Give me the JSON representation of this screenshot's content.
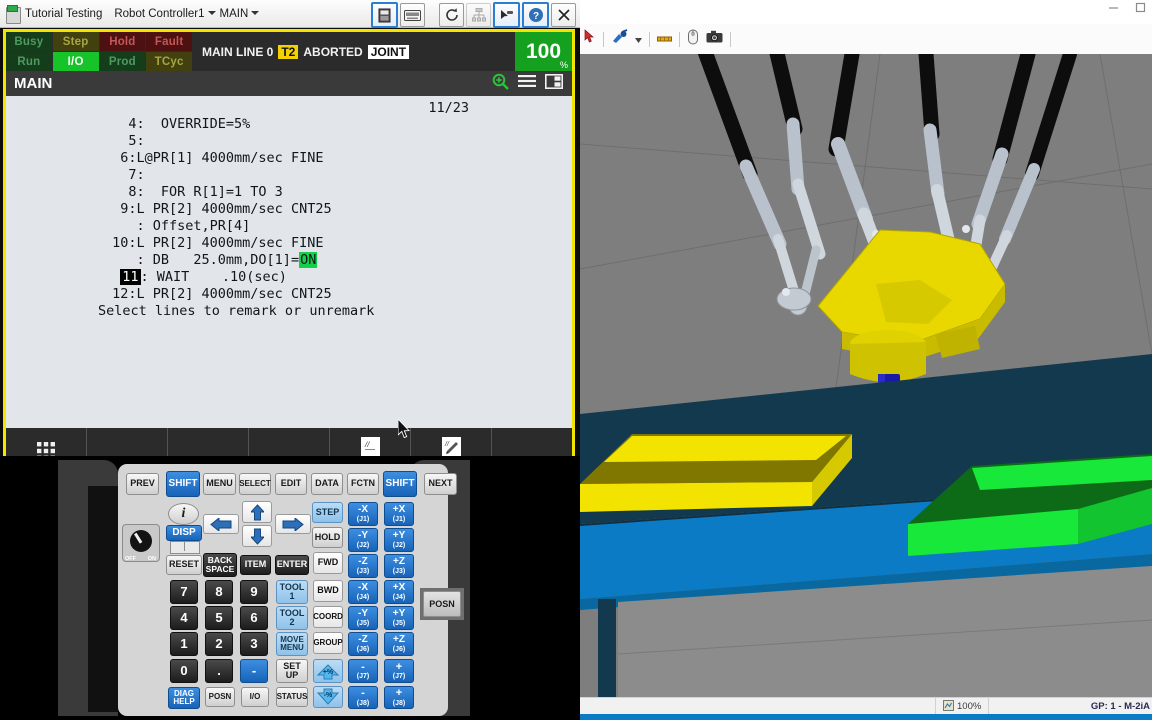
{
  "pendant": {
    "titlebar": {
      "app_title": "Tutorial Testing",
      "controller": "Robot Controller1",
      "program_menu": "MAIN",
      "icons": [
        "pendant-icon",
        "keyboard-icon",
        "reset-icon",
        "hierarchy-icon",
        "pointer-icon",
        "help-icon",
        "close-icon"
      ]
    },
    "leds": [
      {
        "label": "Busy",
        "color": "#153d1c",
        "text": "#4e9b5e",
        "active": false
      },
      {
        "label": "Step",
        "color": "#41400e",
        "text": "#a8a543",
        "active": false
      },
      {
        "label": "Hold",
        "color": "#4d1111",
        "text": "#c45757",
        "active": false
      },
      {
        "label": "Fault",
        "color": "#4d1111",
        "text": "#c45757",
        "active": false
      },
      {
        "label": "Run",
        "color": "#153d1c",
        "text": "#4e9b5e",
        "active": false
      },
      {
        "label": "I/O",
        "color": "#16c42a",
        "text": "#ffffff",
        "active": true
      },
      {
        "label": "Prod",
        "color": "#153d1c",
        "text": "#4e9b5e",
        "active": false
      },
      {
        "label": "TCyc",
        "color": "#41400e",
        "text": "#a8a543",
        "active": false
      }
    ],
    "status_line": {
      "program": "MAIN LINE 0",
      "mode_badge": "T2",
      "state": "ABORTED",
      "coord_badge": "JOINT"
    },
    "override": {
      "value": "100",
      "unit": "%"
    },
    "program_bar": {
      "name": "MAIN",
      "icons": [
        "zoom-in-icon",
        "menu-icon",
        "split-view-icon"
      ]
    },
    "code": {
      "line_counter": "11/23",
      "lines": [
        {
          "num": "4:",
          "text": "  OVERRIDE=5%"
        },
        {
          "num": "5:",
          "text": ""
        },
        {
          "num": "6:L",
          "text": "@PR[1] 4000mm/sec FINE"
        },
        {
          "num": "7:",
          "text": ""
        },
        {
          "num": "8:",
          "text": "  FOR R[1]=1 TO 3"
        },
        {
          "num": "9:L",
          "text": " PR[2] 4000mm/sec CNT25"
        },
        {
          "num": ":",
          "text": " Offset,PR[4]"
        },
        {
          "num": "10:L",
          "text": " PR[2] 4000mm/sec FINE"
        },
        {
          "num": ":",
          "text": " DB   25.0mm,DO[1]=",
          "highlight": "ON"
        },
        {
          "num": "11:",
          "text": " WAIT    .10(sec)",
          "selected": true
        },
        {
          "num": "12:L",
          "text": " PR[2] 4000mm/sec CNT25"
        }
      ],
      "prompt": "Select lines to remark or unremark"
    },
    "softkeys": [
      {
        "label": "",
        "icon": "grid-icon"
      },
      {
        "label": "",
        "icon": ""
      },
      {
        "label": "",
        "icon": ""
      },
      {
        "label": "",
        "icon": ""
      },
      {
        "label": "REMARK",
        "icon": "remark-icon"
      },
      {
        "label": "UNREMARK",
        "icon": "unremark-icon"
      },
      {
        "label": "",
        "icon": ""
      }
    ],
    "keypad": {
      "row_top": [
        "PREV",
        "SHIFT",
        "MENU",
        "SELECT",
        "EDIT",
        "DATA",
        "FCTN",
        "SHIFT",
        "NEXT"
      ],
      "power_switch": {
        "off": "OFF",
        "on": "ON"
      },
      "keys": [
        {
          "label": "i",
          "style": "gray"
        },
        {
          "label": "DISP",
          "style": "blue"
        },
        {
          "label": "RESET",
          "style": "gray"
        },
        {
          "label": "BACK SPACE",
          "style": "dark"
        },
        {
          "label": "ITEM",
          "style": "dark"
        },
        {
          "label": "ENTER",
          "style": "dark"
        },
        {
          "label": "STEP",
          "style": "ltblue"
        },
        {
          "label": "HOLD",
          "style": "gray"
        },
        {
          "label": "FWD",
          "style": "white"
        },
        {
          "label": "BWD",
          "style": "white"
        },
        {
          "label": "COORD",
          "style": "white"
        },
        {
          "label": "GROUP",
          "style": "white"
        },
        {
          "label": "TOOL 1",
          "style": "ltblue"
        },
        {
          "label": "TOOL 2",
          "style": "ltblue"
        },
        {
          "label": "MOVE MENU",
          "style": "ltblue"
        },
        {
          "label": "SET UP",
          "style": "gray"
        },
        {
          "label": "DIAG HELP",
          "style": "blue"
        },
        {
          "label": "POSN",
          "style": "gray"
        },
        {
          "label": "I/O",
          "style": "gray"
        },
        {
          "label": "STATUS",
          "style": "gray"
        }
      ],
      "numpad": [
        "7",
        "8",
        "9",
        "4",
        "5",
        "6",
        "1",
        "2",
        "3",
        "0",
        ".",
        "-"
      ],
      "jog": [
        {
          "axis": "-X",
          "joint": "(J1)"
        },
        {
          "axis": "+X",
          "joint": "(J1)"
        },
        {
          "axis": "-Y",
          "joint": "(J2)"
        },
        {
          "axis": "+Y",
          "joint": "(J2)"
        },
        {
          "axis": "-Z",
          "joint": "(J3)"
        },
        {
          "axis": "+Z",
          "joint": "(J3)"
        },
        {
          "axis": "-X",
          "joint": "(J4)"
        },
        {
          "axis": "+X",
          "joint": "(J4)"
        },
        {
          "axis": "-Y",
          "joint": "(J5)"
        },
        {
          "axis": "+Y",
          "joint": "(J5)"
        },
        {
          "axis": "-Z",
          "joint": "(J6)"
        },
        {
          "axis": "+Z",
          "joint": "(J6)"
        },
        {
          "axis": "-",
          "joint": "(J7)"
        },
        {
          "axis": "+",
          "joint": "(J7)"
        },
        {
          "axis": "-",
          "joint": "(J8)"
        },
        {
          "axis": "+",
          "joint": "(J8)"
        }
      ],
      "pct_keys": [
        "+%",
        "-%"
      ],
      "side_key": "POSN"
    }
  },
  "sim": {
    "toolbar_icons": [
      "pointer-icon",
      "teach-tool-icon",
      "dropdown-caret-icon",
      "measure-icon",
      "mouse-icon",
      "camera-icon"
    ],
    "window_buttons": [
      "minimize-icon",
      "maximize-icon"
    ],
    "status": {
      "zoom": "100%",
      "group": "GP: 1 - M-2iA"
    },
    "scene": {
      "robot": "delta-robot-m2ia",
      "background_color": "#7e7e7e",
      "conveyor_color": "#12394d",
      "band_color": "#0a7bc4",
      "floor_color": "#8c8c8c",
      "parts": [
        {
          "name": "yellow-box",
          "color": "#f2e400"
        },
        {
          "name": "green-box",
          "color": "#17e83a"
        }
      ],
      "end_effector_color": "#e8d800",
      "tool_color": "#1a1aa8",
      "tool_tip_color": "#2ee62e"
    }
  },
  "colors": {
    "pendant_frame": "#f2e600",
    "accent_blue": "#1763b8",
    "active_green": "#16c42a",
    "screen_bg": "#e2e6ea"
  }
}
